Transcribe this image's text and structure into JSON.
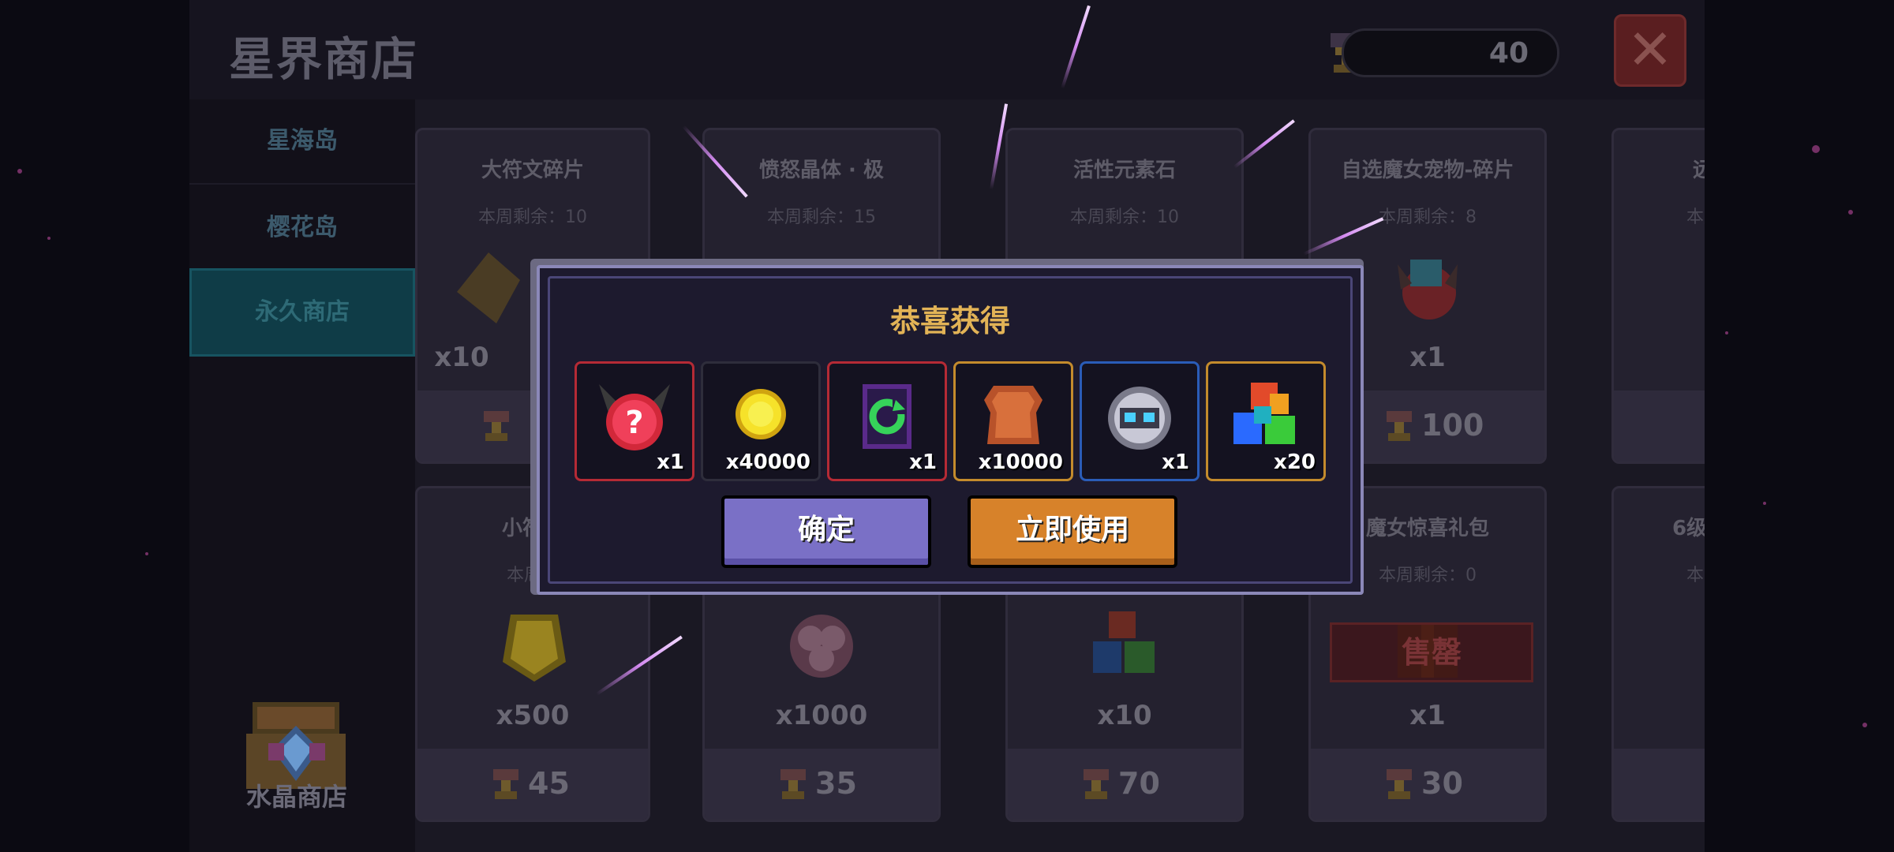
{
  "shop": {
    "title": "星界商店",
    "currency_amount": "40",
    "close_icon": "close-icon"
  },
  "sidebar": {
    "items": [
      {
        "label": "星海岛",
        "active": false
      },
      {
        "label": "樱花岛",
        "active": false
      },
      {
        "label": "永久商店",
        "active": true
      }
    ],
    "crystal_shop_label": "水晶商店"
  },
  "cards": [
    {
      "name": "大符文碎片",
      "remain": "本周剩余：10",
      "qty": "x10",
      "price": ""
    },
    {
      "name": "愤怒晶体 · 极",
      "remain": "本周剩余：15",
      "qty": "",
      "price": ""
    },
    {
      "name": "活性元素石",
      "remain": "本周剩余：10",
      "qty": "",
      "price": ""
    },
    {
      "name": "自选魔女宠物-碎片",
      "remain": "本周剩余：8",
      "qty": "x1",
      "price": "100"
    },
    {
      "name": "远",
      "remain": "本周",
      "qty": "",
      "price": ""
    },
    {
      "name": "小符文",
      "remain": "本周剩",
      "qty": "x500",
      "price": "45"
    },
    {
      "name": "",
      "remain": "",
      "qty": "x1000",
      "price": "35"
    },
    {
      "name": "",
      "remain": "",
      "qty": "x10",
      "price": "70"
    },
    {
      "name": "魔女惊喜礼包",
      "remain": "本周剩余：0",
      "qty": "x1",
      "price": "30",
      "soldout": "售罄"
    },
    {
      "name": "6级",
      "remain": "本",
      "qty": "",
      "price": ""
    }
  ],
  "modal": {
    "title": "恭喜获得",
    "rewards": [
      {
        "icon": "red-mystery-pet-icon",
        "qty": "x1"
      },
      {
        "icon": "gold-coin-icon",
        "qty": "x40000"
      },
      {
        "icon": "refresh-card-icon",
        "qty": "x1"
      },
      {
        "icon": "leather-icon",
        "qty": "x10000"
      },
      {
        "icon": "robot-mask-icon",
        "qty": "x1"
      },
      {
        "icon": "elemental-cubes-icon",
        "qty": "x20"
      }
    ],
    "confirm_label": "确定",
    "use_label": "立即使用"
  }
}
